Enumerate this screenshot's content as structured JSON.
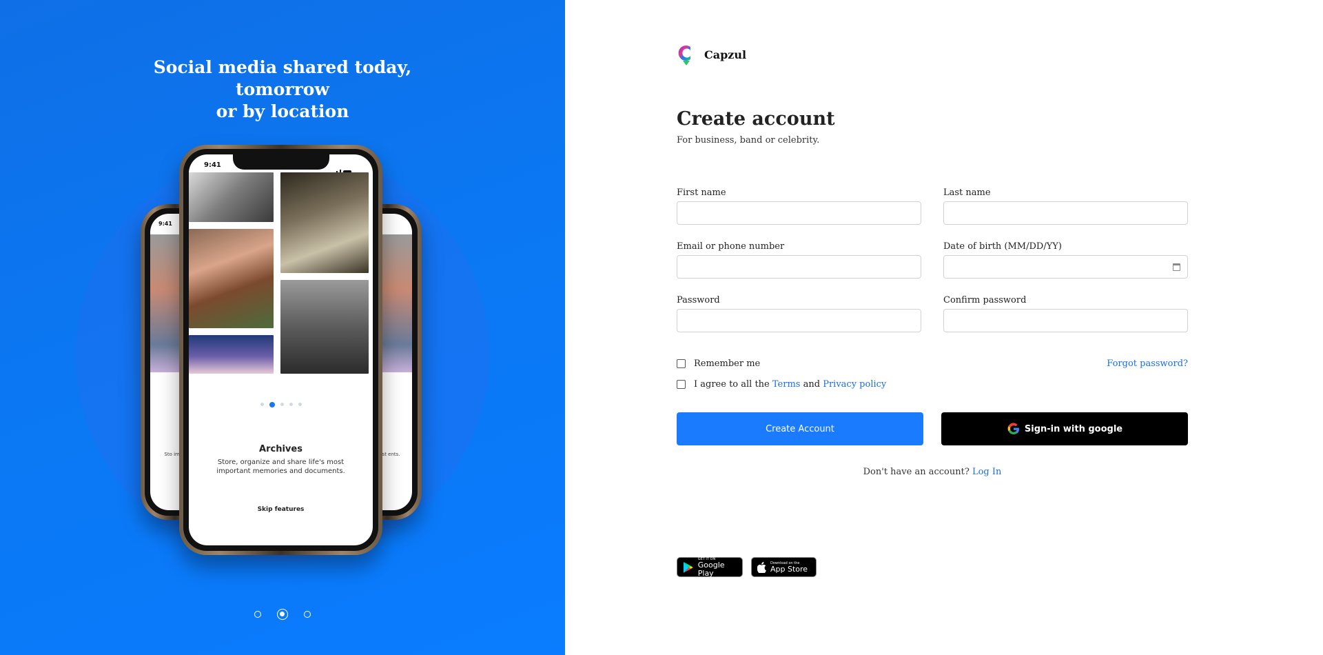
{
  "hero": {
    "title_line1": "Social media shared today, tomorrow",
    "title_line2": "or by location",
    "phone_time": "9:41",
    "slide_title": "Archives",
    "slide_text": "Store, organize and share life's most important memories and documents.",
    "skip_label": "Skip features",
    "back_left_text": "Sto impo",
    "back_right_text": "most ents.",
    "pager_count": 3,
    "pager_active": 2,
    "carousel_dots_active": 2,
    "colors": {
      "background": "#0b77f2",
      "accent": "#1877f2"
    }
  },
  "brand": {
    "name": "Capzul",
    "logo_icon": "capzul-logo-icon"
  },
  "form": {
    "title": "Create account",
    "subtitle": "For business, band or celebrity.",
    "first_name_label": "First name",
    "last_name_label": "Last name",
    "email_label": "Email or phone number",
    "dob_label": "Date of birth (MM/DD/YY)",
    "password_label": "Password",
    "confirm_password_label": "Confirm password",
    "first_name_value": "",
    "last_name_value": "",
    "email_value": "",
    "dob_value": "",
    "password_value": "",
    "confirm_password_value": "",
    "remember_label": "Remember me",
    "forgot_label": "Forgot password?",
    "agree_prefix": "I agree to all the",
    "terms_label": "Terms",
    "agree_and": "and",
    "privacy_label": "Privacy policy",
    "create_button": "Create Account",
    "google_button": "Sign-in with google",
    "no_account_text": "Don't have an account?",
    "login_link": "Log In",
    "colors": {
      "primary": "#1a7bff",
      "link": "#1a6fe0",
      "google_button_bg": "#000000"
    }
  },
  "stores": {
    "google_small": "GET IT ON",
    "google_big": "Google Play",
    "apple_small": "Download on the",
    "apple_big": "App Store"
  }
}
